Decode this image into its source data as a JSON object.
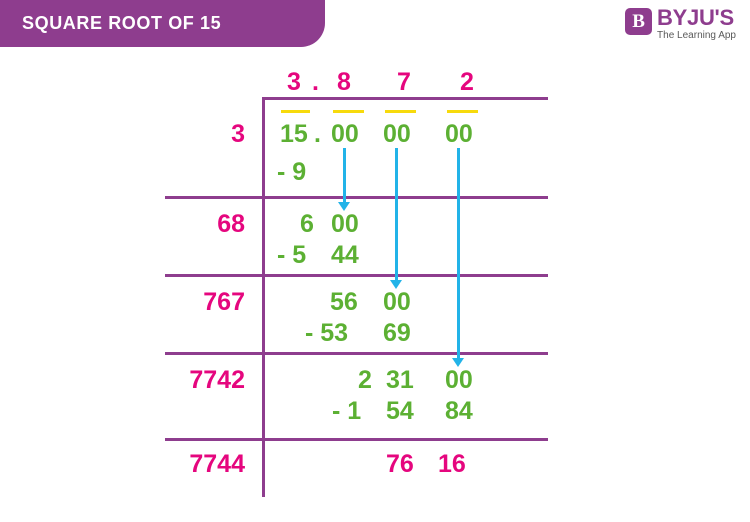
{
  "header": {
    "title": "SQUARE ROOT OF 15",
    "banner_color": "#8e3d8e"
  },
  "brand": {
    "mark_glyph": "B",
    "name": "BYJU'S",
    "tagline": "The Learning App",
    "color": "#8e3d8e"
  },
  "colors": {
    "quotient": "#e5067e",
    "divisor": "#e5067e",
    "work": "#5cb033",
    "remainder": "#e5067e",
    "rule": "#8e3d8e",
    "overbar": "#f7da0c",
    "bringdown": "#22b3e8"
  },
  "division": {
    "quotient": {
      "digits": [
        "3",
        ".",
        "8",
        "7",
        "2"
      ],
      "text": "3 . 8   7   2"
    },
    "dividend": {
      "integer_part": "15",
      "decimal_point": ".",
      "pairs": [
        "00",
        "00",
        "00"
      ],
      "text": "15 . 00  00  00",
      "overbar_count": 4
    },
    "steps": [
      {
        "divisor": "3",
        "bring_down": "",
        "value": "15",
        "subtrahend": "- 9",
        "value_text": "15 . 00  00  00"
      },
      {
        "divisor": "68",
        "value": "6 00",
        "subtrahend": "- 5  44"
      },
      {
        "divisor": "767",
        "value": "56 00",
        "subtrahend": "- 53  69"
      },
      {
        "divisor": "7742",
        "value": "2 31 00",
        "subtrahend": "- 1  54  84"
      },
      {
        "divisor": "7744",
        "value": "76 16",
        "is_remainder": true
      }
    ],
    "cells": {
      "q_3": "3",
      "q_point": ".",
      "q_8": "8",
      "q_7": "7",
      "q_2": "2",
      "d_15": "15",
      "d_point": ".",
      "d_p1": "00",
      "d_p2": "00",
      "d_p3": "00",
      "div1": "3",
      "sub1": "- 9",
      "div2": "68",
      "r2_a": "6",
      "r2_b": "00",
      "sub2": "- 5",
      "sub2_b": "44",
      "div3": "767",
      "r3_a": "56",
      "r3_b": "00",
      "sub3": "- 53",
      "sub3_b": "69",
      "div4": "7742",
      "r4_a": "2",
      "r4_b": "31",
      "r4_c": "00",
      "sub4": "- 1",
      "sub4_b": "54",
      "sub4_c": "84",
      "div5": "7744",
      "rem_a": "76",
      "rem_b": "16"
    }
  }
}
